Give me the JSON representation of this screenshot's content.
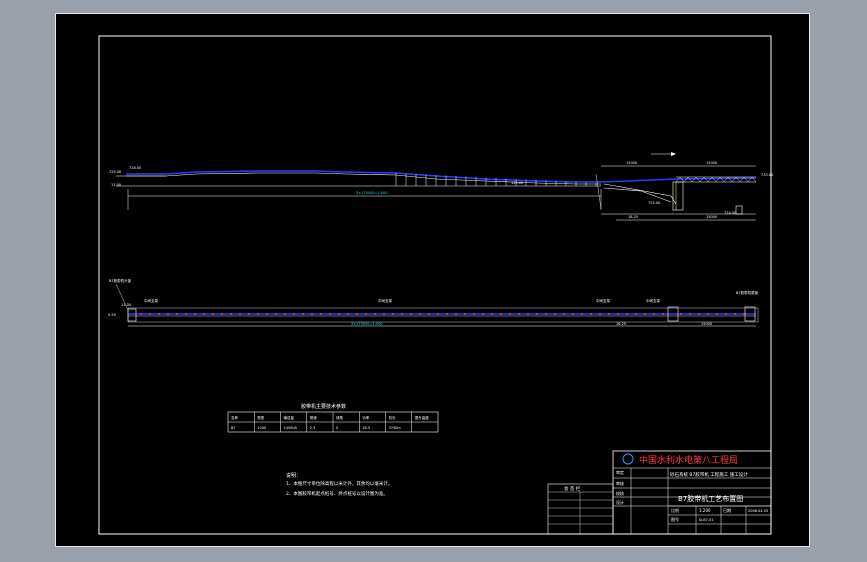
{
  "drawing": {
    "plan_title_label": "B7",
    "elevation_dims": {
      "left_elev": "729.00",
      "left_elev2": "728.00",
      "left_offset": "11.00",
      "main_len": "3×175000=1:000",
      "mid_elev": "125.00",
      "right_top": "15000",
      "right_top2": "15000",
      "right_elev": "733.00",
      "right_low": "725.00",
      "right_low2": "724.00",
      "right_seg": "18.25",
      "right_dim": "15000"
    },
    "plan_dims": {
      "left_note": "B7胶带机头部",
      "left_dim": "11.00",
      "left_small": "0.50",
      "main_len": "3×175000=1:000",
      "mid_label": "中间支架",
      "mid_label2": "中间支架",
      "right_label": "中间支架",
      "right_label2": "中间支架",
      "right_note": "B7胶带机尾部",
      "right_dim": "15000",
      "right_dim2": "18.25"
    },
    "table": {
      "caption": "胶带机主要技术参数",
      "headers": [
        "名称",
        "带宽",
        "输送量",
        "带速",
        "倾角",
        "功率",
        "机长",
        "提升高度"
      ],
      "row": [
        "B7",
        "1000",
        "1450t/h",
        "2.5",
        "0",
        "18.5",
        "3740m"
      ]
    },
    "notes": {
      "heading": "说明：",
      "line1": "1、本图尺寸单位除高程以米计外，其余均以毫米计。",
      "line2": "2、本图胶带机起点桩号、终点桩号以设计图为准。"
    },
    "titleblock": {
      "company": "中国水利水电第八工程局",
      "project": "砂石系统 B7胶带机 工程施工 施工设计",
      "drawing_title": "B7胶带机工艺布置图",
      "sign_label": "会 签 栏",
      "rows": [
        "审定",
        "审核",
        "校核",
        "设计"
      ],
      "scale_label": "比例",
      "scale_value": "1:200",
      "date_label": "日期",
      "date_value": "2006.04.05",
      "drawing_no_label": "图号",
      "drawing_no_value": "SJ-B7-01"
    }
  },
  "colors": {
    "background": "#99a0aa",
    "canvas": "#000000",
    "line_white": "#ffffff",
    "line_blue": "#2a3cff",
    "line_red": "#ff3b3b",
    "line_cyan": "#20e0e0",
    "line_yellow": "#e8e820"
  }
}
